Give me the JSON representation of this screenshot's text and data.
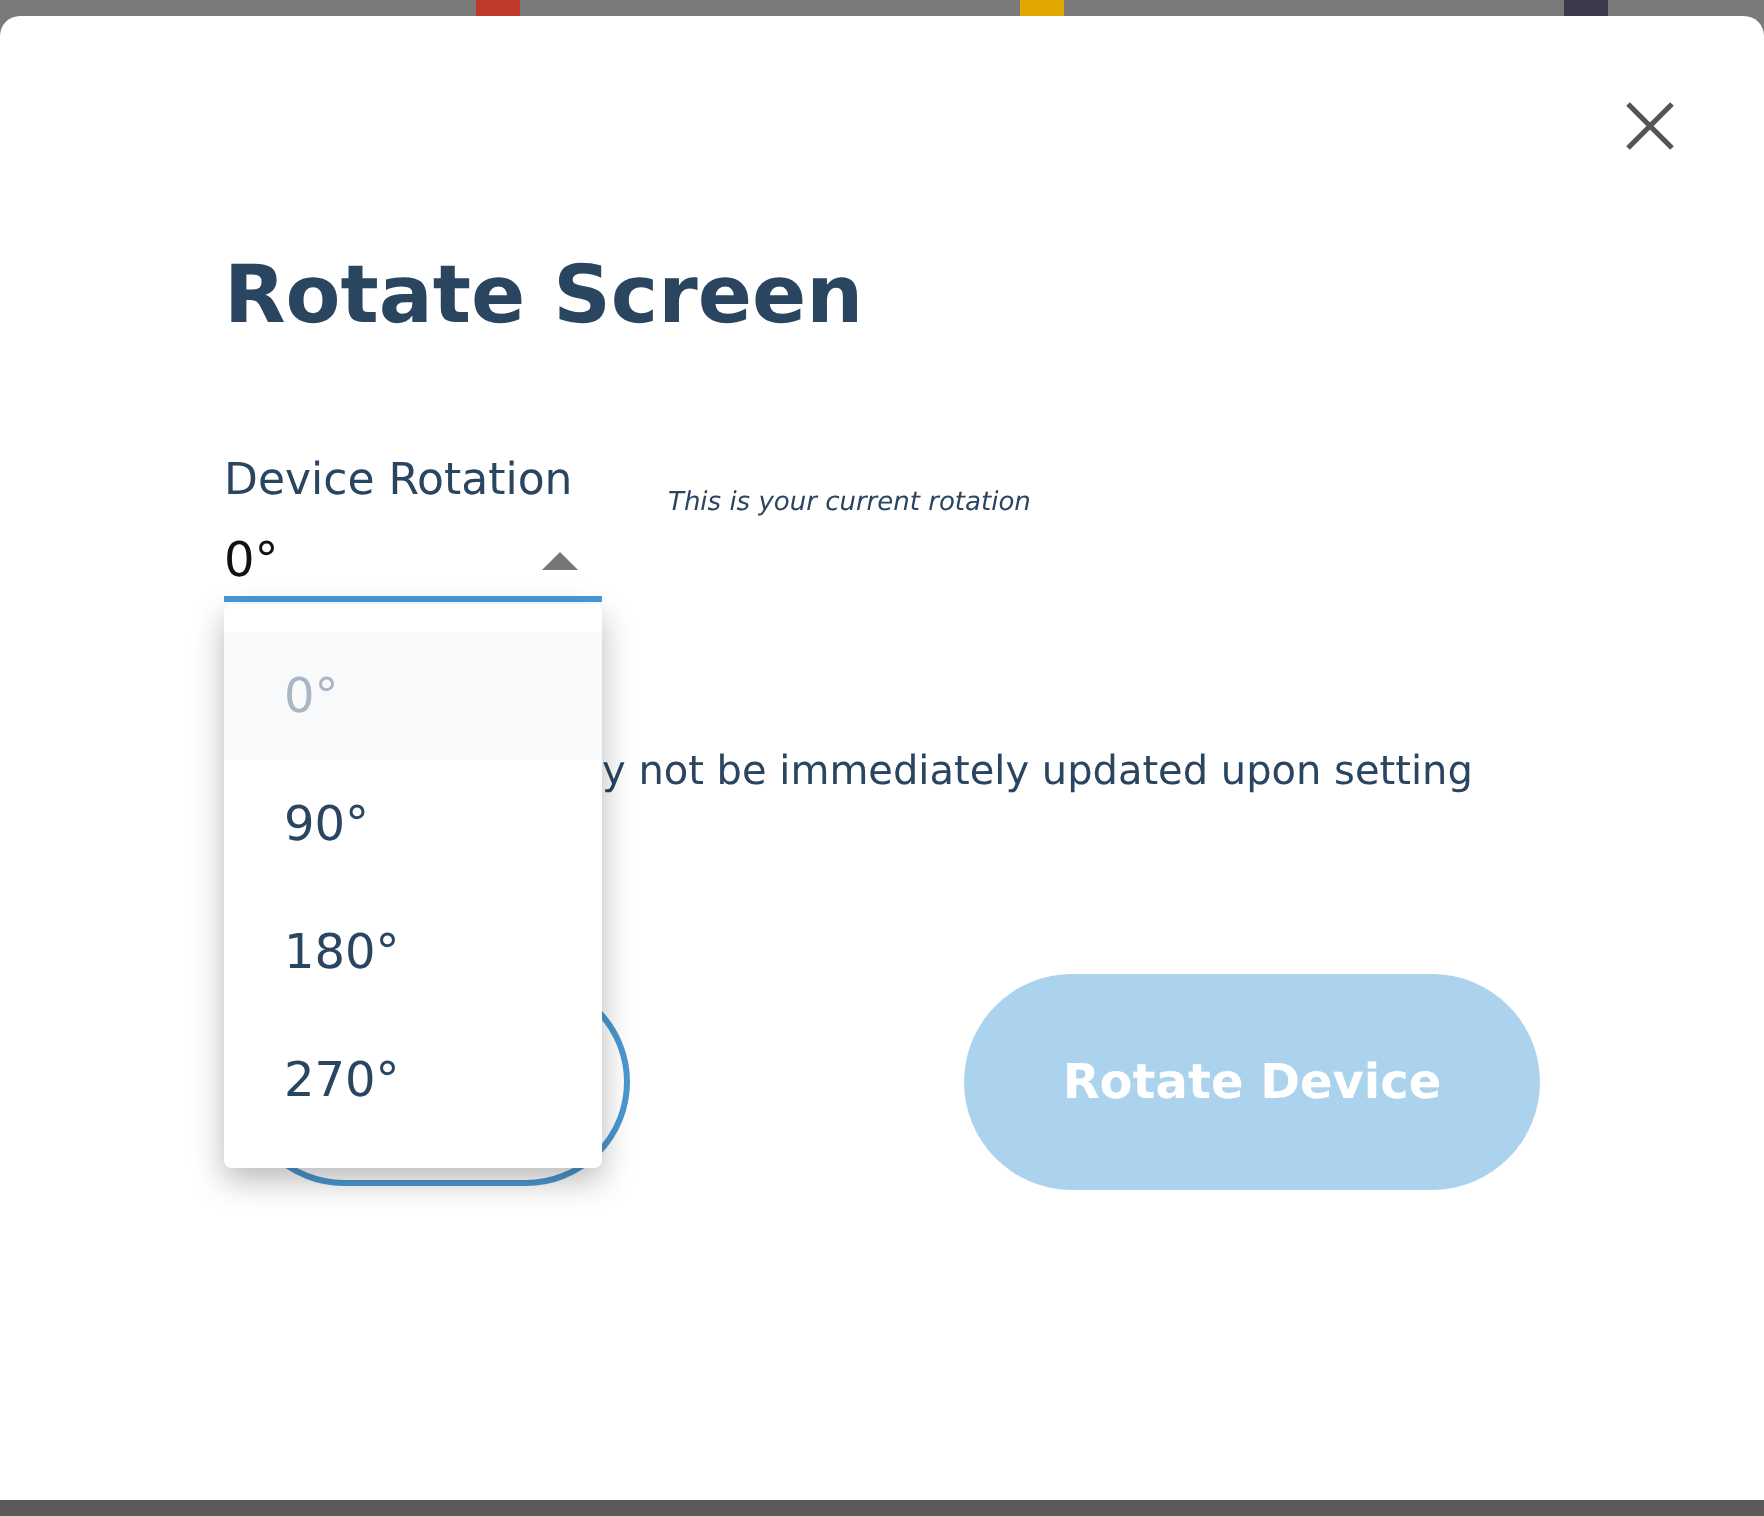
{
  "background_badges": [
    {
      "color": "#c0392b"
    },
    {
      "color": "#e0a800"
    },
    {
      "color": "#3a3a4a"
    }
  ],
  "dialog": {
    "title": "Rotate Screen",
    "field_label": "Device Rotation",
    "value": "0°",
    "hint": "This is your current rotation",
    "note": "y not be immediately updated upon setting",
    "primary_button": {
      "label": "Rotate Device",
      "disabled": true
    }
  },
  "dropdown": {
    "expanded": true,
    "options": [
      {
        "label": "0°",
        "selected": true
      },
      {
        "label": "90°",
        "selected": false
      },
      {
        "label": "180°",
        "selected": false
      },
      {
        "label": "270°",
        "selected": false
      }
    ]
  }
}
